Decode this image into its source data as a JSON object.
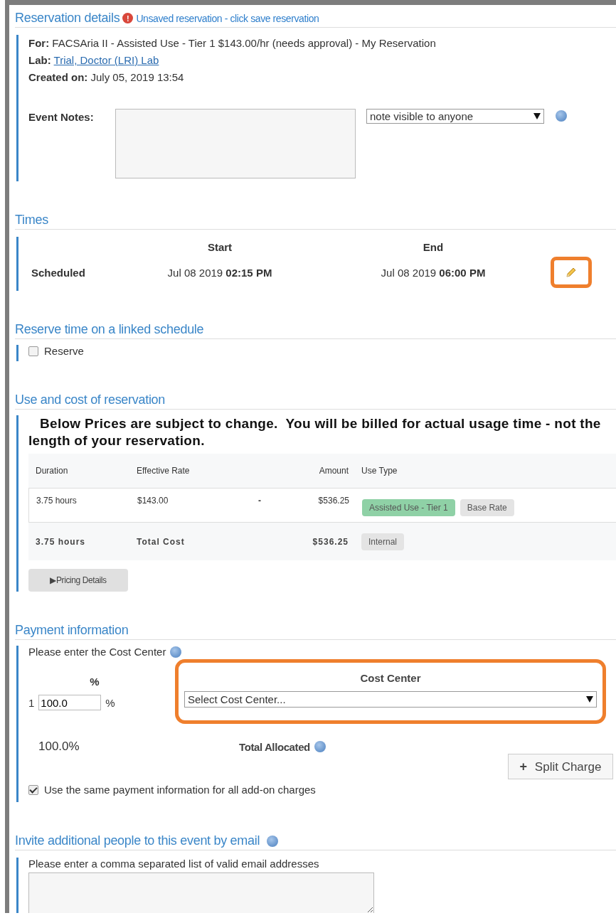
{
  "details": {
    "title": "Reservation details",
    "warning": "!",
    "unsaved_link": "Unsaved reservation - click save reservation",
    "for_label": "For:",
    "for_value": "FACSAria II - Assisted Use - Tier 1 $143.00/hr (needs approval) - My Reservation",
    "lab_label": "Lab:",
    "lab_link": "Trial, Doctor (LRI) Lab",
    "created_label": "Created on:",
    "created_value": "July 05, 2019 13:54",
    "notes_label": "Event Notes:",
    "visibility": "note visible to anyone"
  },
  "times": {
    "title": "Times",
    "start_header": "Start",
    "end_header": "End",
    "row_label": "Scheduled",
    "start_date": "Jul 08 2019",
    "start_time": "02:15 PM",
    "end_date": "Jul 08 2019",
    "end_time": "06:00 PM",
    "edit_highlighted": true
  },
  "linked": {
    "title": "Reserve time on a linked schedule",
    "checkbox": {
      "label": "Reserve",
      "checked": false
    }
  },
  "cost": {
    "title": "Use and cost of reservation",
    "notice": "Below Prices are subject to change.  You will be billed for actual usage time - not the length of your reservation.",
    "columns": [
      "Duration",
      "Effective Rate",
      "Amount",
      "Use Type"
    ],
    "rows": [
      {
        "duration": "3.75 hours",
        "rate": "$143.00",
        "column_3": "-",
        "amount": "$536.25",
        "tags": [
          {
            "label": "Assisted Use - Tier 1",
            "color": "#8fd1a6"
          },
          {
            "label": "Base Rate",
            "color": "#e4e4e4"
          }
        ]
      }
    ],
    "total": {
      "duration": "3.75 hours",
      "label": "Total Cost",
      "amount": "$536.25",
      "tags": [
        {
          "label": "Internal",
          "color": "#e4e4e4"
        }
      ]
    },
    "pricing_button": "Pricing Details",
    "pricing_arrow": "▶"
  },
  "payment": {
    "title": "Payment information",
    "prompt": "Please enter the Cost Center",
    "percent_header": "%",
    "cost_center_header": "Cost Center",
    "allocations": [
      {
        "index": "1",
        "value": "100.0",
        "unit": "%",
        "cost_center": "Select Cost Center..."
      }
    ],
    "cost_center_highlighted": true,
    "total_value": "100.0%",
    "total_label": "Total Allocated",
    "split_plus": "+",
    "split_button": "Split Charge",
    "same_payment": {
      "label": "Use the same payment information for all add-on charges",
      "checked": true
    }
  },
  "invite": {
    "title": "Invite additional people to this event by email",
    "prompt": "Please enter a comma separated list of valid email addresses"
  }
}
